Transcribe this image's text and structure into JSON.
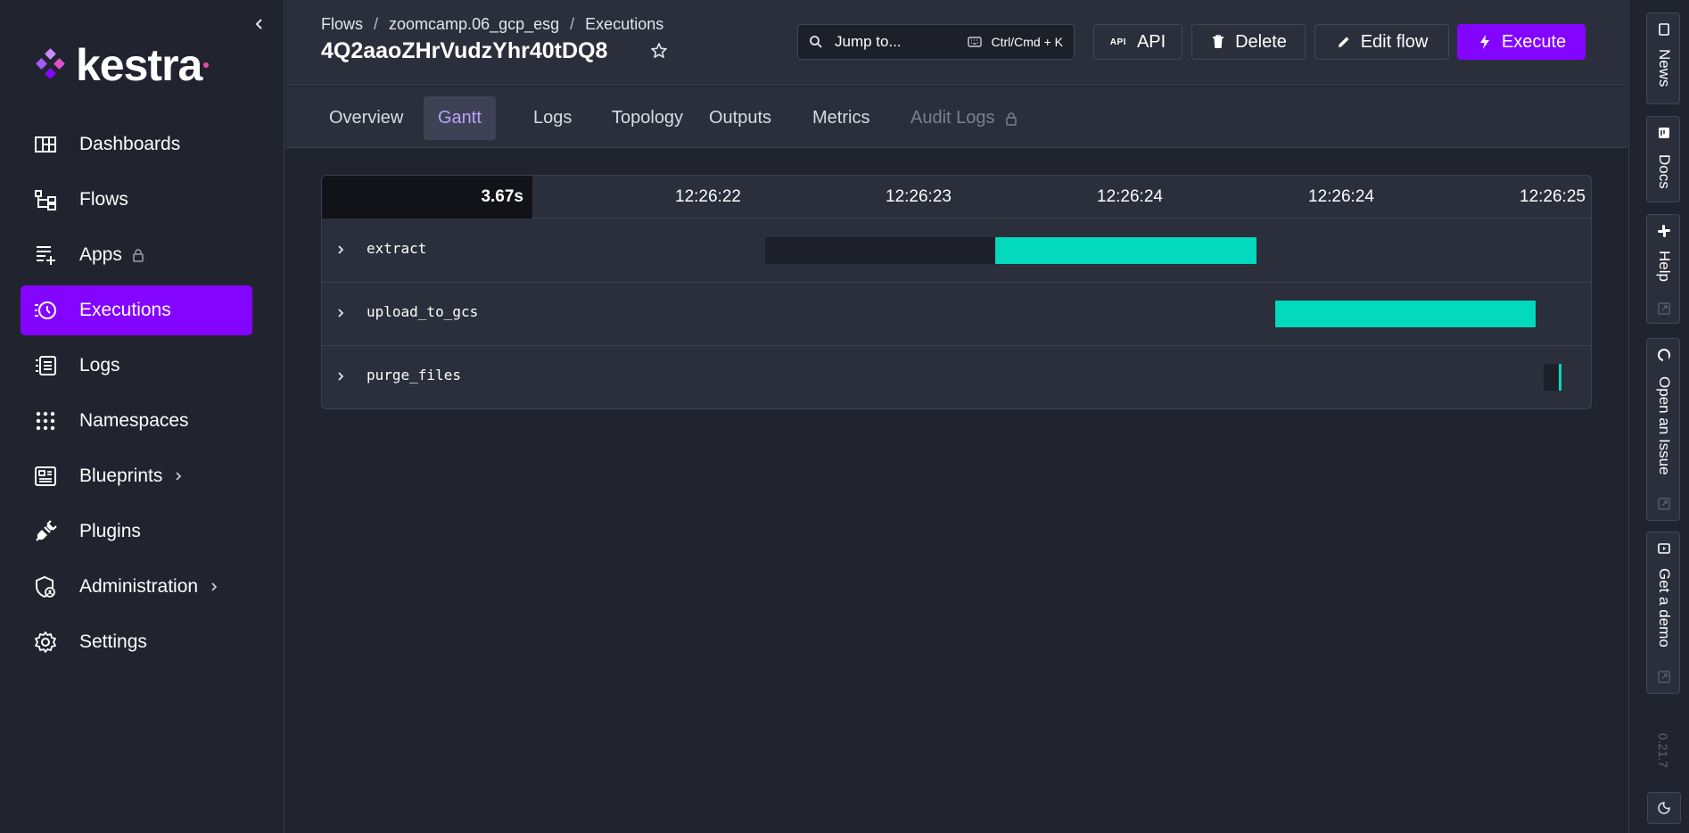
{
  "brand": {
    "name": "kestra",
    "accent": "#8405ff",
    "logo_dot_color": "#e74ea8"
  },
  "sidebar": {
    "collapse_icon": "chevron-left-icon",
    "items": [
      {
        "label": "Dashboards",
        "icon": "dashboard-icon"
      },
      {
        "label": "Flows",
        "icon": "flows-icon"
      },
      {
        "label": "Apps",
        "icon": "apps-icon",
        "locked": true
      },
      {
        "label": "Executions",
        "icon": "executions-icon",
        "active": true
      },
      {
        "label": "Logs",
        "icon": "logs-icon"
      },
      {
        "label": "Namespaces",
        "icon": "namespaces-icon"
      },
      {
        "label": "Blueprints",
        "icon": "blueprints-icon",
        "has_submenu": true
      },
      {
        "label": "Plugins",
        "icon": "plugins-icon"
      },
      {
        "label": "Administration",
        "icon": "administration-icon",
        "has_submenu": true
      },
      {
        "label": "Settings",
        "icon": "settings-icon"
      }
    ]
  },
  "header": {
    "breadcrumb": [
      "Flows",
      "zoomcamp.06_gcp_esg",
      "Executions"
    ],
    "breadcrumb_sep": "/",
    "title": "4Q2aaoZHrVudzYhr40tDQ8",
    "jump": {
      "label": "Jump to...",
      "shortcut": "Ctrl/Cmd + K"
    },
    "buttons": {
      "api_tag": "API",
      "api": "API",
      "delete": "Delete",
      "edit": "Edit flow",
      "execute": "Execute"
    }
  },
  "tabs": [
    {
      "label": "Overview"
    },
    {
      "label": "Gantt",
      "active": true
    },
    {
      "label": "Logs"
    },
    {
      "label": "Topology"
    },
    {
      "label": "Outputs"
    },
    {
      "label": "Metrics"
    },
    {
      "label": "Audit Logs",
      "disabled": true,
      "locked": true
    }
  ],
  "gantt": {
    "duration": "3.67s",
    "ticks": [
      "12:26:22",
      "12:26:23",
      "12:26:24",
      "12:26:24",
      "12:26:25"
    ],
    "colors": {
      "running": "#03d9bc",
      "waiting": "#1d1f29"
    },
    "tasks": [
      {
        "name": "extract",
        "wait_start": 0.3496,
        "run_start": 0.5309,
        "run_end": 0.7362
      },
      {
        "name": "upload_to_gcs",
        "wait_start": 0.7515,
        "run_start": 0.7515,
        "run_end": 0.9566
      },
      {
        "name": "purge_files",
        "wait_start": 0.9625,
        "run_start": 0.9745,
        "run_end": 0.977
      }
    ]
  },
  "rail": {
    "items": [
      {
        "label": "News",
        "icon": "news-icon"
      },
      {
        "label": "Docs",
        "icon": "docs-icon"
      },
      {
        "label": "Help",
        "icon": "slack-icon",
        "external": true
      },
      {
        "label": "Open an Issue",
        "icon": "github-icon",
        "external": true
      },
      {
        "label": "Get a demo",
        "icon": "demo-icon",
        "external": true
      }
    ],
    "version": "0.21.7"
  }
}
